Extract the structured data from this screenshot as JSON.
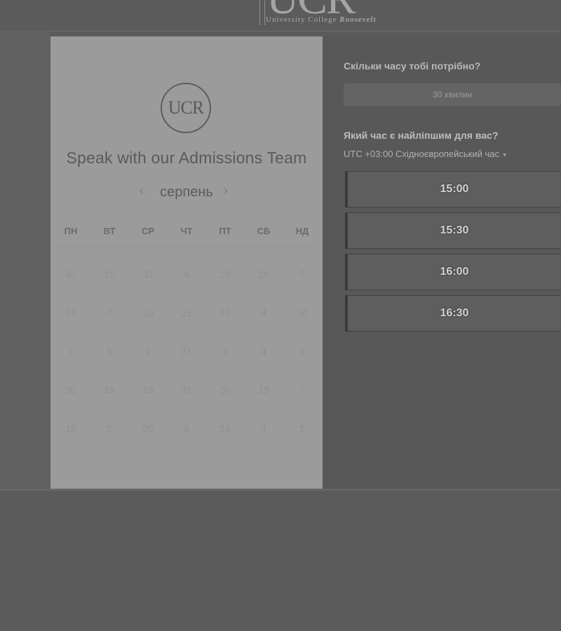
{
  "header": {
    "logo_text": "UCR",
    "logo_subtitle": "University College",
    "logo_subtitle_bold": "Roosevelt"
  },
  "card": {
    "logo_text": "UCR",
    "title": "Speak with our Admissions Team",
    "month": "серпень",
    "prev_icon": "‹",
    "next_icon": "›",
    "weekdays": [
      "ПН",
      "ВТ",
      "СР",
      "ЧТ",
      "ПТ",
      "СБ",
      "НД"
    ],
    "weeks": [
      [
        "31",
        "15",
        "31",
        "4",
        "19",
        "26",
        "5"
      ],
      [
        "24",
        "7",
        "20",
        "21",
        "31",
        "4",
        "30"
      ],
      [
        "7",
        "5",
        "2",
        "31",
        "3",
        "4",
        "3"
      ],
      [
        "20",
        "19",
        "19",
        "31",
        "30",
        "19",
        "7"
      ],
      [
        "18",
        "2",
        "20",
        "6",
        "19",
        "4",
        "1"
      ]
    ]
  },
  "booking": {
    "duration_question": "Скільки часу тобі потрібно?",
    "duration_value": "30 хвилин",
    "time_question": "Який час є найліпшим для вас?",
    "timezone": "UTC +03:00 Східноєвропейський час",
    "timezone_icon": "▾",
    "slots": [
      "15:00",
      "15:30",
      "16:00",
      "16:30"
    ]
  }
}
